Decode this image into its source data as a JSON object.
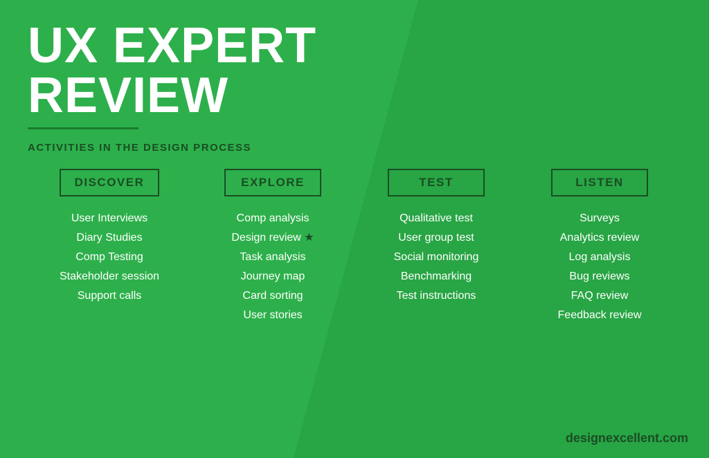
{
  "title_line1": "UX EXPERT",
  "title_line2": "REVIEW",
  "subtitle": "ACTIVITIES IN THE DESIGN PROCESS",
  "domain": "designexcellent.com",
  "columns": [
    {
      "id": "discover",
      "label": "DISCOVER",
      "items": [
        {
          "text": "User Interviews",
          "star": false
        },
        {
          "text": "Diary Studies",
          "star": false
        },
        {
          "text": "Comp Testing",
          "star": false
        },
        {
          "text": "Stakeholder session",
          "star": false
        },
        {
          "text": "Support calls",
          "star": false
        }
      ]
    },
    {
      "id": "explore",
      "label": "EXPLORE",
      "items": [
        {
          "text": "Comp analysis",
          "star": false
        },
        {
          "text": "Design review",
          "star": true
        },
        {
          "text": "Task analysis",
          "star": false
        },
        {
          "text": "Journey map",
          "star": false
        },
        {
          "text": "Card sorting",
          "star": false
        },
        {
          "text": "User stories",
          "star": false
        }
      ]
    },
    {
      "id": "test",
      "label": "TEST",
      "items": [
        {
          "text": "Qualitative test",
          "star": false
        },
        {
          "text": "User group test",
          "star": false
        },
        {
          "text": "Social monitoring",
          "star": false
        },
        {
          "text": "Benchmarking",
          "star": false
        },
        {
          "text": "Test instructions",
          "star": false
        }
      ]
    },
    {
      "id": "listen",
      "label": "LISTEN",
      "items": [
        {
          "text": "Surveys",
          "star": false
        },
        {
          "text": "Analytics review",
          "star": false
        },
        {
          "text": "Log analysis",
          "star": false
        },
        {
          "text": "Bug reviews",
          "star": false
        },
        {
          "text": "FAQ review",
          "star": false
        },
        {
          "text": "Feedback review",
          "star": false
        }
      ]
    }
  ]
}
